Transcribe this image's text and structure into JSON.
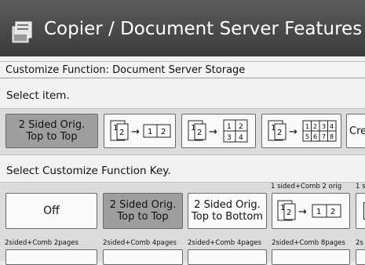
{
  "header": {
    "title": "Copier / Document Server Features"
  },
  "customize_function": "Customize Function: Document Server Storage",
  "select_item": {
    "label": "Select item.",
    "items": [
      {
        "label": "2 Sided Orig.\nTop to Top",
        "selected": true
      },
      {
        "diagram": "2→1 2"
      },
      {
        "diagram": "2→1 2 / 3 4"
      },
      {
        "diagram": "2→1 2 3 4 / 5 6 7 8"
      },
      {
        "label": "Crea"
      }
    ]
  },
  "select_key": {
    "label": "Select Customize Function Key.",
    "caption_top": "1 sided+Comb 2 orig",
    "caption_top_cut": "1 s",
    "buttons": [
      {
        "label": "Off",
        "selected": false
      },
      {
        "label": "2 Sided Orig.\nTop to Top",
        "selected": true
      },
      {
        "label": "2 Sided Orig.\nTop to Bottom",
        "selected": false
      }
    ],
    "bottom_captions": [
      "2sided+Comb 2pages",
      "2sided+Comb 4pages",
      "2sided+Comb 4pages",
      "2sided+Comb 8pages",
      "2s"
    ]
  },
  "digits": {
    "a": "1",
    "b": "2",
    "c": "1",
    "d": "2",
    "e": "1",
    "f": "2",
    "g": "1",
    "h": "2",
    "i": "3",
    "j": "4",
    "k": "1",
    "l": "2",
    "m": "1",
    "n": "2",
    "o": "3",
    "p": "4",
    "q": "5",
    "r": "6",
    "s": "7",
    "t": "8",
    "u": "1",
    "v": "2",
    "w": "1",
    "x": "2"
  },
  "arrow": "→"
}
